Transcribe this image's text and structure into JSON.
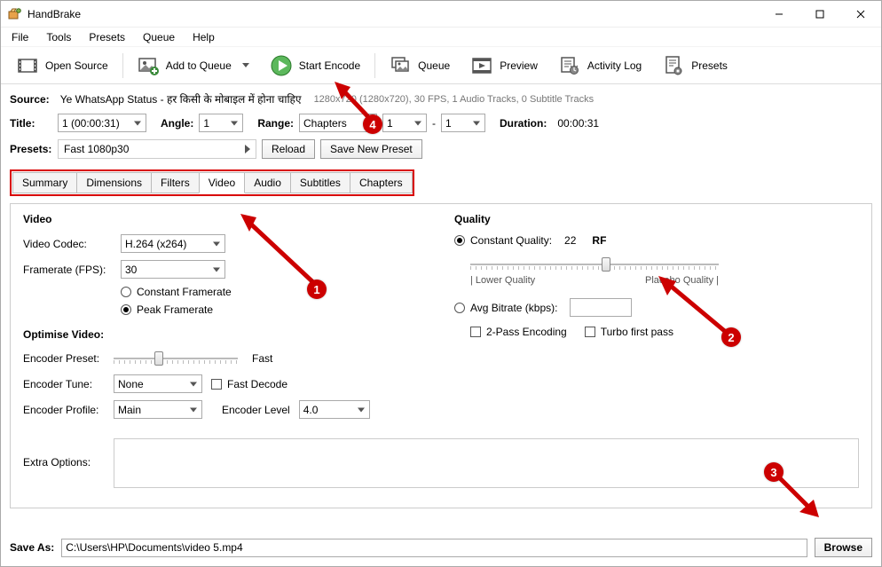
{
  "window": {
    "title": "HandBrake"
  },
  "menu": {
    "file": "File",
    "tools": "Tools",
    "presets": "Presets",
    "queue": "Queue",
    "help": "Help"
  },
  "toolbar": {
    "open_source": "Open Source",
    "add_to_queue": "Add to Queue",
    "start_encode": "Start Encode",
    "queue": "Queue",
    "preview": "Preview",
    "activity_log": "Activity Log",
    "presets": "Presets"
  },
  "source": {
    "label": "Source:",
    "name": "Ye WhatsApp Status - हर किसी के मोबाइल में होना चाहिए",
    "meta": "1280x720 (1280x720), 30 FPS, 1 Audio Tracks, 0 Subtitle Tracks"
  },
  "title_row": {
    "title_label": "Title:",
    "title_value": "1 (00:00:31)",
    "angle_label": "Angle:",
    "angle_value": "1",
    "range_label": "Range:",
    "range_type": "Chapters",
    "range_from": "1",
    "range_sep": "-",
    "range_to": "1",
    "duration_label": "Duration:",
    "duration_value": "00:00:31"
  },
  "presets_row": {
    "label": "Presets:",
    "current": "Fast 1080p30",
    "reload": "Reload",
    "save_new": "Save New Preset"
  },
  "tabs": {
    "summary": "Summary",
    "dimensions": "Dimensions",
    "filters": "Filters",
    "video": "Video",
    "audio": "Audio",
    "subtitles": "Subtitles",
    "chapters": "Chapters"
  },
  "video": {
    "heading": "Video",
    "codec_label": "Video Codec:",
    "codec_value": "H.264 (x264)",
    "fps_label": "Framerate (FPS):",
    "fps_value": "30",
    "cfr": "Constant Framerate",
    "pfr": "Peak Framerate",
    "optimise_heading": "Optimise Video:",
    "enc_preset_label": "Encoder Preset:",
    "enc_preset_value": "Fast",
    "enc_tune_label": "Encoder Tune:",
    "enc_tune_value": "None",
    "fast_decode": "Fast Decode",
    "enc_profile_label": "Encoder Profile:",
    "enc_profile_value": "Main",
    "enc_level_label": "Encoder Level",
    "enc_level_value": "4.0",
    "extra_label": "Extra Options:"
  },
  "quality": {
    "heading": "Quality",
    "cq_label": "Constant Quality:",
    "cq_value": "22",
    "rf": "RF",
    "lower": "| Lower Quality",
    "placebo": "Placebo Quality |",
    "avg_label": "Avg Bitrate (kbps):",
    "two_pass": "2-Pass Encoding",
    "turbo": "Turbo first pass"
  },
  "save": {
    "label": "Save As:",
    "path": "C:\\Users\\HP\\Documents\\video 5.mp4",
    "browse": "Browse"
  },
  "anno": {
    "n1": "1",
    "n2": "2",
    "n3": "3",
    "n4": "4"
  }
}
